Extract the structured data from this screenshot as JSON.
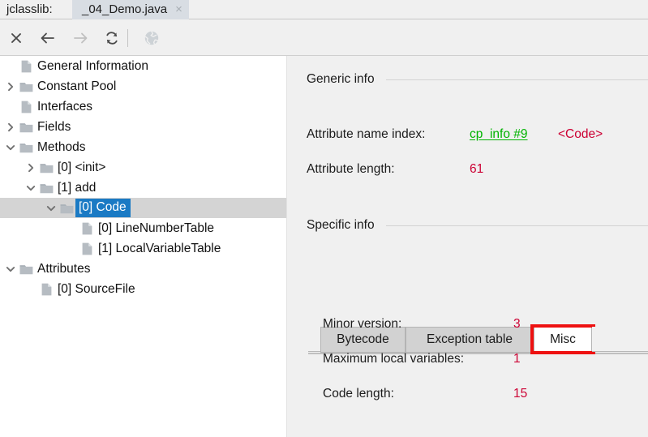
{
  "titlebar": {
    "app_label": "jclasslib:",
    "file_tab": "_04_Demo.java",
    "close_glyph": "×"
  },
  "toolbar": {
    "buttons": [
      {
        "name": "close-icon",
        "title": "Close",
        "enabled": true
      },
      {
        "name": "back-icon",
        "title": "Back",
        "enabled": true
      },
      {
        "name": "forward-icon",
        "title": "Forward",
        "enabled": false
      },
      {
        "name": "reload-icon",
        "title": "Reload",
        "enabled": true
      },
      {
        "name": "browse-icon",
        "title": "Browse",
        "enabled": false
      }
    ]
  },
  "tree": {
    "items": [
      {
        "label": "General Information",
        "indent": 0,
        "icon": "file",
        "toggle": "none",
        "selected": false
      },
      {
        "label": "Constant Pool",
        "indent": 0,
        "icon": "folder",
        "toggle": "collapsed",
        "selected": false
      },
      {
        "label": "Interfaces",
        "indent": 0,
        "icon": "file",
        "toggle": "none",
        "selected": false
      },
      {
        "label": "Fields",
        "indent": 0,
        "icon": "folder",
        "toggle": "collapsed",
        "selected": false
      },
      {
        "label": "Methods",
        "indent": 0,
        "icon": "folder",
        "toggle": "expanded",
        "selected": false
      },
      {
        "label": "[0] <init>",
        "indent": 1,
        "icon": "folder",
        "toggle": "collapsed",
        "selected": false
      },
      {
        "label": "[1] add",
        "indent": 1,
        "icon": "folder",
        "toggle": "expanded",
        "selected": false
      },
      {
        "label": "[0] Code",
        "indent": 2,
        "icon": "folder",
        "toggle": "expanded",
        "selected": true
      },
      {
        "label": "[0] LineNumberTable",
        "indent": 3,
        "icon": "file",
        "toggle": "none",
        "selected": false
      },
      {
        "label": "[1] LocalVariableTable",
        "indent": 3,
        "icon": "file",
        "toggle": "none",
        "selected": false
      },
      {
        "label": "Attributes",
        "indent": 0,
        "icon": "folder",
        "toggle": "expanded",
        "selected": false
      },
      {
        "label": "[0] SourceFile",
        "indent": 1,
        "icon": "file",
        "toggle": "none",
        "selected": false
      }
    ]
  },
  "detail": {
    "generic": {
      "title": "Generic info",
      "rows": [
        {
          "label": "Attribute name index:",
          "value": "cp_info #9",
          "value_style": "link",
          "extra": "<Code>"
        },
        {
          "label": "Attribute length:",
          "value": "61",
          "value_style": "red",
          "extra": ""
        }
      ]
    },
    "specific": {
      "title": "Specific info",
      "tabs": [
        {
          "label": "Bytecode",
          "active": false,
          "highlighted": false
        },
        {
          "label": "Exception table",
          "active": false,
          "highlighted": false
        },
        {
          "label": "Misc",
          "active": true,
          "highlighted": true
        }
      ],
      "rows": [
        {
          "label": "Minor version:",
          "value": "3"
        },
        {
          "label": "Maximum local variables:",
          "value": "1"
        },
        {
          "label": "Code length:",
          "value": "15"
        }
      ]
    }
  },
  "colors": {
    "link_green": "#00b300",
    "value_red": "#cc0033",
    "selection_blue": "#1a7ac4",
    "highlight_red": "#ee1111"
  }
}
